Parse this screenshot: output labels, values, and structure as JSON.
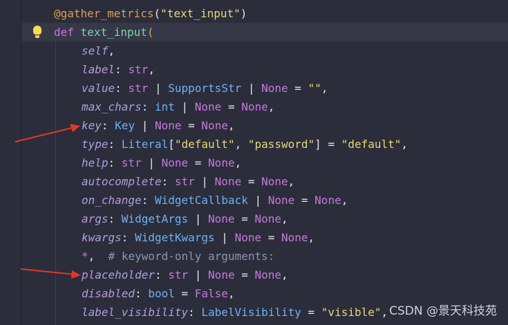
{
  "decorator": "@gather_metrics(\"text_input\")",
  "def_keyword": "def",
  "function_name": "text_input",
  "open_paren": "(",
  "params": [
    {
      "name": "self",
      "rest": ","
    },
    {
      "name": "label",
      "rest": ": str,"
    },
    {
      "name": "value",
      "rest": ": str | SupportsStr | None = \"\","
    },
    {
      "name": "max_chars",
      "rest": ": int | None = None,"
    },
    {
      "name": "key",
      "rest": ": Key | None = None,"
    },
    {
      "name": "type",
      "rest": ": Literal[\"default\", \"password\"] = \"default\","
    },
    {
      "name": "help",
      "rest": ": str | None = None,"
    },
    {
      "name": "autocomplete",
      "rest": ": str | None = None,"
    },
    {
      "name": "on_change",
      "rest": ": WidgetCallback | None = None,"
    },
    {
      "name": "args",
      "rest": ": WidgetArgs | None = None,"
    },
    {
      "name": "kwargs",
      "rest": ": WidgetKwargs | None = None,"
    },
    {
      "name": "*",
      "rest": ",  # keyword-only arguments:"
    },
    {
      "name": "placeholder",
      "rest": ": str | None = None,"
    },
    {
      "name": "disabled",
      "rest": ": bool = False,"
    },
    {
      "name": "label_visibility",
      "rest": ": LabelVisibility = \"visible\","
    }
  ],
  "tokens": {
    "decor_name": "@gather_metrics",
    "decor_arg": "\"text_input\"",
    "line_self": "self",
    "line_label": "label",
    "line_value": "value",
    "line_max_chars": "max_chars",
    "line_key": "key",
    "line_type": "type",
    "line_help": "help",
    "line_autocomplete": "autocomplete",
    "line_on_change": "on_change",
    "line_args": "args",
    "line_kwargs": "kwargs",
    "line_star": "*",
    "line_placeholder": "placeholder",
    "line_disabled": "disabled",
    "line_label_visibility": "label_visibility",
    "str_t": "str",
    "int_t": "int",
    "bool_t": "bool",
    "None": "None",
    "False": "False",
    "Key": "Key",
    "Literal": "Literal",
    "SupportsStr": "SupportsStr",
    "WidgetCallback": "WidgetCallback",
    "WidgetArgs": "WidgetArgs",
    "WidgetKwargs": "WidgetKwargs",
    "LabelVisibility": "LabelVisibility",
    "empty_str": "\"\"",
    "default_str": "\"default\"",
    "password_str": "\"password\"",
    "visible_str": "\"visible\"",
    "comment": "# keyword-only arguments:"
  },
  "watermark": "CSDN @景天科技苑",
  "colors": {
    "background": "#2b2d3a",
    "current_line": "#363848",
    "keyword": "#c679dd",
    "function": "#7dd3a8",
    "type": "#6fb1f5",
    "string": "#e6d77e",
    "param": "#b39de0",
    "arrow": "#e2372b"
  }
}
